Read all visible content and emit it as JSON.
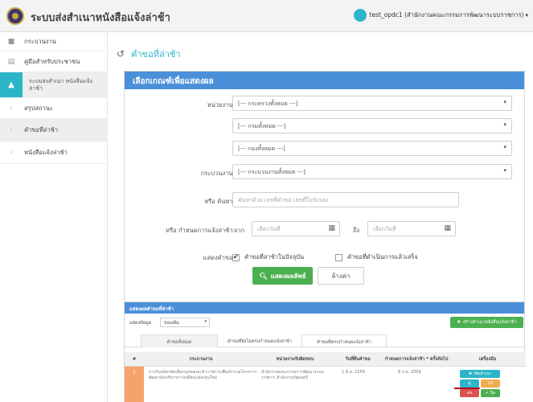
{
  "header": {
    "app_title": "ระบบส่งสำเนาหนังสือแจ้งล่าช้า",
    "user_name": "test_opdc1 (สำนักงานคณะกรรมการพัฒนาระบบราชการ)",
    "logo_icon": "seal-logo-icon",
    "accent_color": "#2bb5c8"
  },
  "sidebar": {
    "items": [
      {
        "label": "กระบวนงาน",
        "icon": "folder-icon"
      },
      {
        "label": "คู่มือสำหรับประชาชน",
        "icon": "book-icon"
      },
      {
        "label": "ระบบส่งสำเนา หนังสือแจ้งล่าช้า",
        "icon": "warning-icon"
      },
      {
        "label": "สรุปสถานะ",
        "icon": "chevron-right-icon"
      },
      {
        "label": "คำขอที่ล่าช้า",
        "icon": "chevron-right-icon"
      },
      {
        "label": "หนังสือแจ้งล่าช้า",
        "icon": "chevron-right-icon"
      }
    ]
  },
  "page": {
    "title": "คำขอที่ล่าช้า",
    "title_icon": "history-icon"
  },
  "criteria": {
    "panel_title": "เลือกเกณฑ์เพื่อแสดงผล",
    "agency_label": "หน่วยงาน:",
    "ministry_select": "[--- กระทรวงทั้งหมด ---]",
    "department_select": "[--- กรมทั้งหมด ---]",
    "division_select": "[--- กองทั้งหมด ---]",
    "process_label": "กระบวนงาน:",
    "process_select": "[--- กระบวนงานทั้งหมด ---]",
    "keyword_label": "หรือ ค้นหา:",
    "keyword_placeholder": "ค้นหาด้วย เลขที่คำขอ เลขที่ใบรับรอง",
    "date_label": "หรือ กำหนดการแจ้งล่าช้า:",
    "from_label": "จาก",
    "from_placeholder": "เลือกวันที่",
    "to_label": "ถึง",
    "to_placeholder": "เลือกวันที่",
    "display_label": "แสดงคำขอ:",
    "check_current": "คำขอที่ล่าช้าในปัจจุบัน",
    "check_done": "คำขอที่ดำเนินการแล้วเสร็จ",
    "show_button": "แสดงผลลัพธ์",
    "clear_button": "ล้างค่า"
  },
  "results": {
    "panel_title": "แสดงผลคำขอที่ล่าช้า",
    "show_label": "แสดงข้อมูล",
    "show_select": "ของเดิม",
    "create_button": "สร้างสำเนาหนังสือแจ้งล่าช้า",
    "tabs": [
      "คำขอทั้งหมด",
      "คำขอที่ยังไม่ครบกำหนดแจ้งล่าช้า",
      "คำขอที่ครบกำหนดแจ้งล่าช้า"
    ],
    "columns": [
      "#",
      "กระบวนงาน",
      "หน่วยงานรับผิดชอบ",
      "วันที่ยื่นคำขอ",
      "กำหนดการแจ้งล่าช้า * ครั้งถัดไป",
      "เครื่องมือ"
    ],
    "rows": [
      {
        "num": "1",
        "process": "การรับสมัครคัดเลือกบุคคลและข้าราชการเพื่อเข้าร่วมโครงการพัฒนานักบริหารการเปลี่ยนแปลงรุ่นใหม่",
        "agency": "สำนักงานคณะกรรมการพัฒนาระบบราชการ สำนักงานรัฐมนตรี",
        "submit_date": "1 มี.ค. 2558",
        "next_notice": "8 ก.ค. 2558",
        "actions": [
          "เพิ่มสำเนา",
          "ดู",
          "แก้",
          "ลบ",
          "ปิด"
        ]
      }
    ]
  }
}
